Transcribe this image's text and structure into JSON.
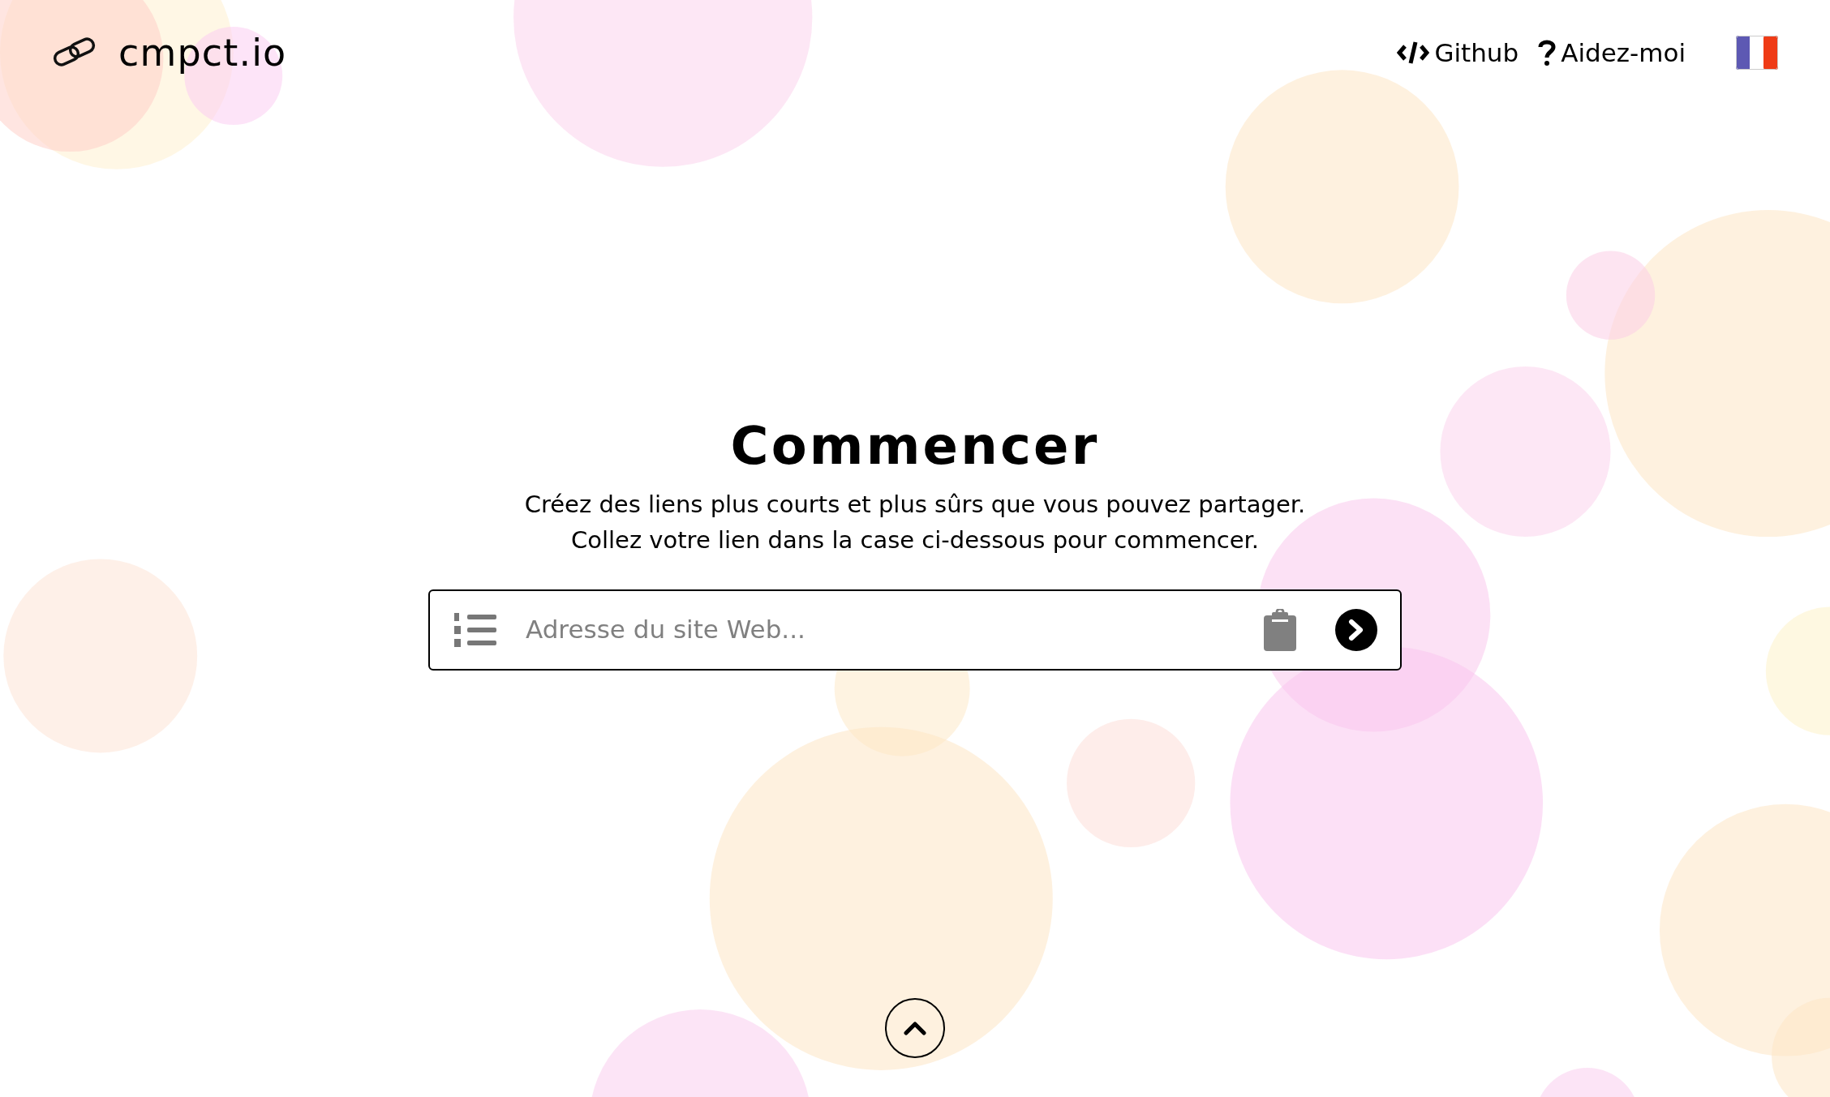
{
  "header": {
    "logo": "cmpct.io",
    "nav": [
      {
        "kind": "code",
        "label": "Github"
      },
      {
        "kind": "help",
        "label": "Aidez-moi"
      }
    ],
    "language": {
      "kind": "fr"
    }
  },
  "hero": {
    "title": "Commencer",
    "lines": [
      "Créez des liens plus courts et plus sûrs que vous pouvez partager.",
      "Collez votre lien dans la case ci-dessous pour commencer."
    ]
  },
  "url_input": {
    "placeholder": "Adresse du site Web..."
  }
}
